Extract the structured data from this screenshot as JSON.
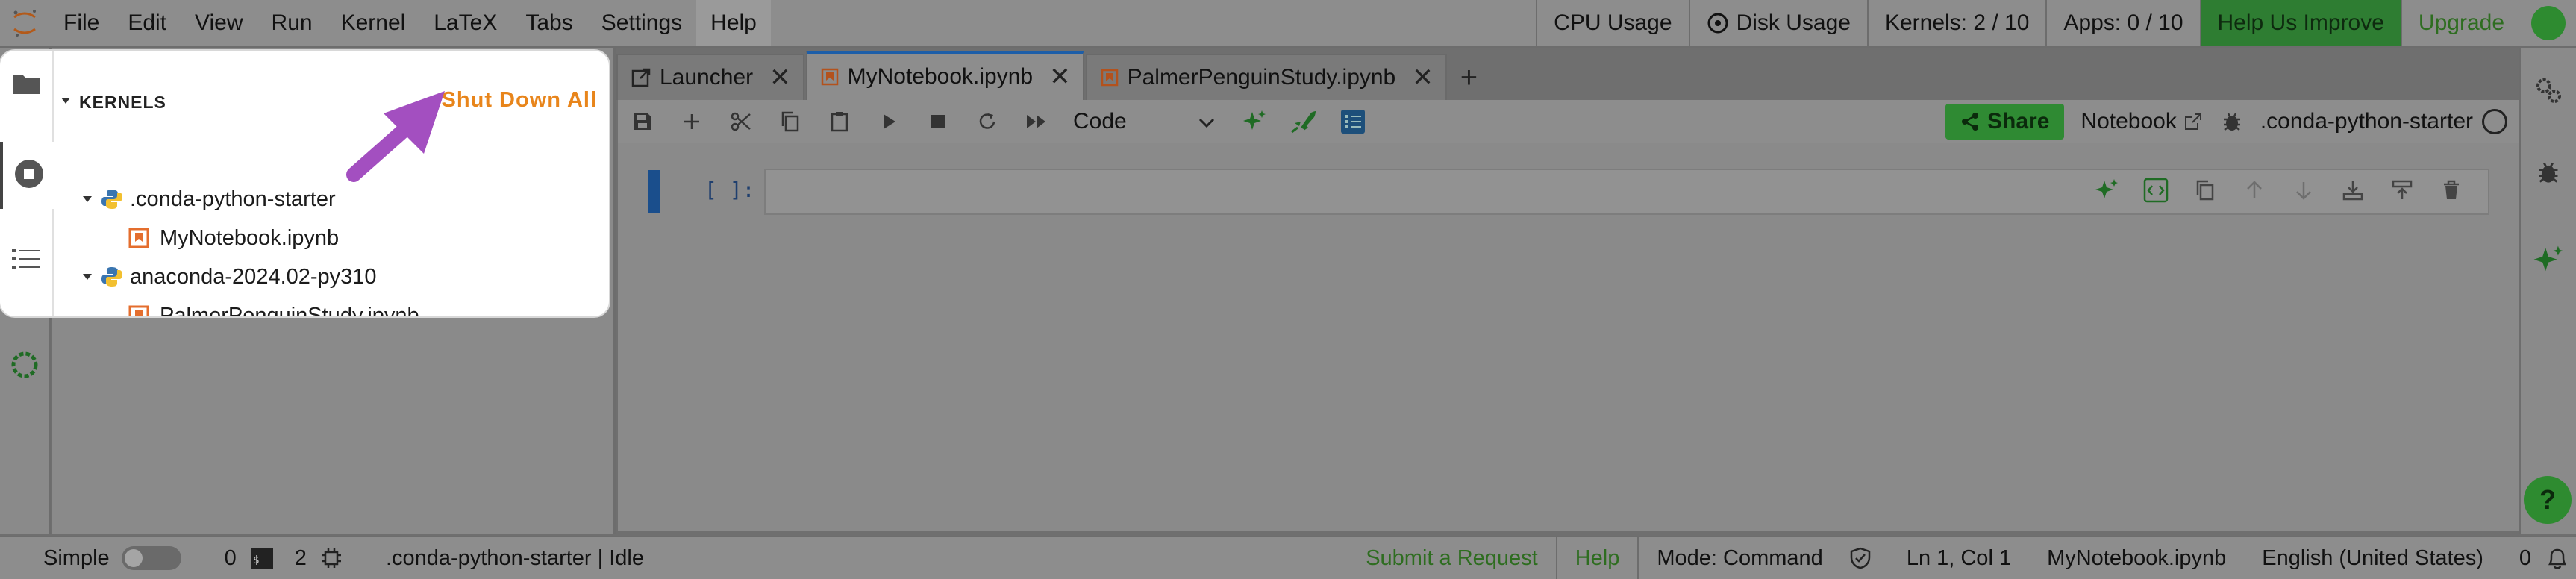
{
  "menu": [
    "File",
    "Edit",
    "View",
    "Run",
    "Kernel",
    "LaTeX",
    "Tabs",
    "Settings",
    "Help"
  ],
  "topbar": {
    "cpu_usage": "CPU Usage",
    "disk_usage": "Disk Usage",
    "kernels": "Kernels: 2 / 10",
    "apps": "Apps: 0 / 10",
    "help_improve": "Help Us Improve",
    "upgrade": "Upgrade"
  },
  "kernels_panel": {
    "title": "KERNELS",
    "shutdown_all": "Shut Down All",
    "kernels": [
      {
        "name": ".conda-python-starter",
        "notebooks": [
          "MyNotebook.ipynb"
        ]
      },
      {
        "name": "anaconda-2024.02-py310",
        "notebooks": [
          "PalmerPenguinStudy.ipynb"
        ]
      }
    ]
  },
  "tabs": [
    {
      "label": "Launcher",
      "icon": "launcher-icon",
      "active": false
    },
    {
      "label": "MyNotebook.ipynb",
      "icon": "notebook-icon",
      "active": true
    },
    {
      "label": "PalmerPenguinStudy.ipynb",
      "icon": "notebook-icon",
      "active": false
    }
  ],
  "toolbar": {
    "cell_type": "Code",
    "share": "Share",
    "notebook_mode": "Notebook",
    "kernel_name": ".conda-python-starter"
  },
  "cell": {
    "prompt": "[ ]:"
  },
  "statusbar": {
    "mode_label": "Simple",
    "terminals_count": "0",
    "kernels_count": "2",
    "kernel_status": ".conda-python-starter | Idle",
    "submit_request": "Submit a Request",
    "help": "Help",
    "mode": "Mode: Command",
    "cursor": "Ln 1, Col 1",
    "file": "MyNotebook.ipynb",
    "language": "English (United States)",
    "notifications": "0"
  },
  "colors": {
    "accent_orange": "#e8851b",
    "arrow_purple": "#a34fc0",
    "active_tab": "#1d5ea8",
    "green": "#2e8b30"
  }
}
